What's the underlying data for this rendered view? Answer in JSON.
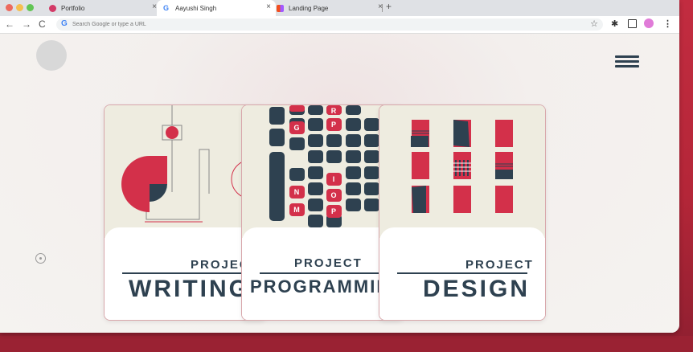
{
  "window": {
    "traffic_lights": [
      {
        "name": "close",
        "color": "#ed6a5e"
      },
      {
        "name": "minimize",
        "color": "#f5bf4f"
      },
      {
        "name": "zoom",
        "color": "#61c554"
      }
    ]
  },
  "tabs": [
    {
      "label": "Portfolio",
      "favicon": "pink-circle-icon",
      "active": false
    },
    {
      "label": "Aayushi Singh",
      "favicon": "google-icon",
      "active": true
    },
    {
      "label": "Landing Page",
      "favicon": "figma-icon",
      "active": false
    }
  ],
  "omnibox": {
    "placeholder": "Search Google or type a URL"
  },
  "page": {
    "cards": [
      {
        "kicker": "PROJECT",
        "title": "WRITING"
      },
      {
        "kicker": "PROJECT",
        "title": "PROGRAMMING"
      },
      {
        "kicker": "PROJECT",
        "title": "DESIGN"
      }
    ],
    "keyboard_letters": [
      "R",
      "G",
      "P",
      "I",
      "N",
      "O",
      "M",
      "P"
    ]
  },
  "colors": {
    "accent_red": "#d3304a",
    "navy": "#2e4150",
    "cream": "#eeece0"
  }
}
